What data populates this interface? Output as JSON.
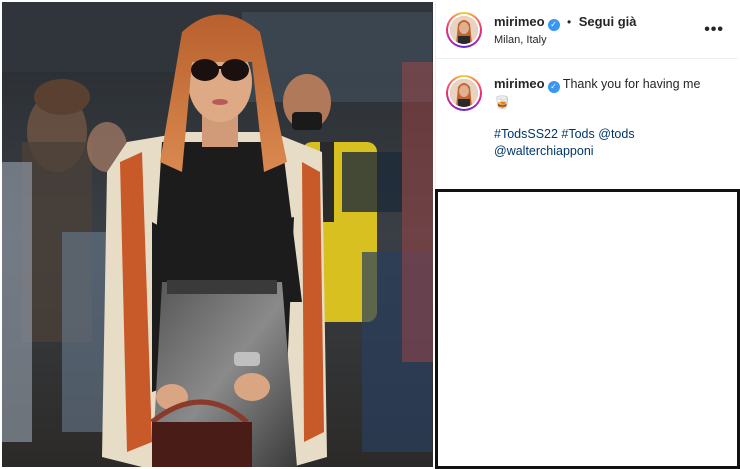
{
  "post": {
    "header": {
      "username": "mirimeo",
      "verified_mark": "✓",
      "separator": "•",
      "follow_label": "Segui già",
      "location": "Milan, Italy",
      "more_label": "•••"
    },
    "caption": {
      "username": "mirimeo",
      "verified_mark": "✓",
      "text": "Thank you for having me",
      "emoji": "🥃",
      "hashtags": "#TodsSS22 #Tods",
      "mention_1": "@tods",
      "mention_2": "@walterchiapponi"
    },
    "icons": {
      "verified": "verified-badge-icon",
      "more": "more-options-icon"
    },
    "colors": {
      "link": "#00376b",
      "verified": "#3897f0",
      "text": "#262626"
    }
  }
}
